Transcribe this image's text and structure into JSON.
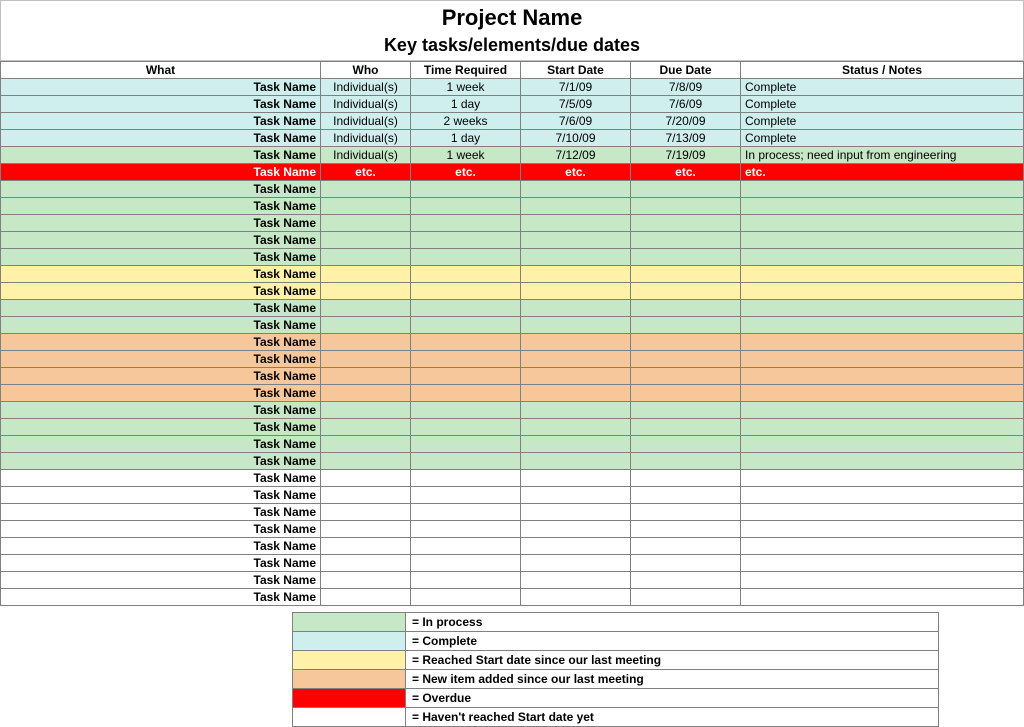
{
  "title": "Project Name",
  "subtitle": "Key tasks/elements/due dates",
  "headers": {
    "what": "What",
    "who": "Who",
    "time": "Time Required",
    "start": "Start Date",
    "due": "Due Date",
    "status": "Status / Notes"
  },
  "rows": [
    {
      "color": "blue",
      "what": "Task Name",
      "who": "Individual(s)",
      "time": "1 week",
      "start": "7/1/09",
      "due": "7/8/09",
      "status": "Complete"
    },
    {
      "color": "blue",
      "what": "Task Name",
      "who": "Individual(s)",
      "time": "1 day",
      "start": "7/5/09",
      "due": "7/6/09",
      "status": "Complete"
    },
    {
      "color": "blue",
      "what": "Task Name",
      "who": "Individual(s)",
      "time": "2 weeks",
      "start": "7/6/09",
      "due": "7/20/09",
      "status": "Complete"
    },
    {
      "color": "blue",
      "what": "Task Name",
      "who": "Individual(s)",
      "time": "1 day",
      "start": "7/10/09",
      "due": "7/13/09",
      "status": "Complete"
    },
    {
      "color": "green",
      "what": "Task Name",
      "who": "Individual(s)",
      "time": "1 week",
      "start": "7/12/09",
      "due": "7/19/09",
      "status": "In process; need input from engineering"
    },
    {
      "color": "red",
      "what": "Task Name",
      "who": "etc.",
      "time": "etc.",
      "start": "etc.",
      "due": "etc.",
      "status": "etc."
    },
    {
      "color": "green",
      "what": "Task Name",
      "who": "",
      "time": "",
      "start": "",
      "due": "",
      "status": ""
    },
    {
      "color": "green",
      "what": "Task Name",
      "who": "",
      "time": "",
      "start": "",
      "due": "",
      "status": ""
    },
    {
      "color": "green",
      "what": "Task Name",
      "who": "",
      "time": "",
      "start": "",
      "due": "",
      "status": ""
    },
    {
      "color": "green",
      "what": "Task Name",
      "who": "",
      "time": "",
      "start": "",
      "due": "",
      "status": ""
    },
    {
      "color": "green",
      "what": "Task Name",
      "who": "",
      "time": "",
      "start": "",
      "due": "",
      "status": ""
    },
    {
      "color": "yellow",
      "what": "Task Name",
      "who": "",
      "time": "",
      "start": "",
      "due": "",
      "status": ""
    },
    {
      "color": "yellow",
      "what": "Task Name",
      "who": "",
      "time": "",
      "start": "",
      "due": "",
      "status": ""
    },
    {
      "color": "green",
      "what": "Task Name",
      "who": "",
      "time": "",
      "start": "",
      "due": "",
      "status": ""
    },
    {
      "color": "green",
      "what": "Task Name",
      "who": "",
      "time": "",
      "start": "",
      "due": "",
      "status": ""
    },
    {
      "color": "orange",
      "what": "Task Name",
      "who": "",
      "time": "",
      "start": "",
      "due": "",
      "status": ""
    },
    {
      "color": "orange",
      "what": "Task Name",
      "who": "",
      "time": "",
      "start": "",
      "due": "",
      "status": ""
    },
    {
      "color": "orange",
      "what": "Task Name",
      "who": "",
      "time": "",
      "start": "",
      "due": "",
      "status": ""
    },
    {
      "color": "orange",
      "what": "Task Name",
      "who": "",
      "time": "",
      "start": "",
      "due": "",
      "status": ""
    },
    {
      "color": "green",
      "what": "Task Name",
      "who": "",
      "time": "",
      "start": "",
      "due": "",
      "status": ""
    },
    {
      "color": "green",
      "what": "Task Name",
      "who": "",
      "time": "",
      "start": "",
      "due": "",
      "status": ""
    },
    {
      "color": "green",
      "what": "Task Name",
      "who": "",
      "time": "",
      "start": "",
      "due": "",
      "status": ""
    },
    {
      "color": "green",
      "what": "Task Name",
      "who": "",
      "time": "",
      "start": "",
      "due": "",
      "status": ""
    },
    {
      "color": "white",
      "what": "Task Name",
      "who": "",
      "time": "",
      "start": "",
      "due": "",
      "status": ""
    },
    {
      "color": "white",
      "what": "Task Name",
      "who": "",
      "time": "",
      "start": "",
      "due": "",
      "status": ""
    },
    {
      "color": "white",
      "what": "Task Name",
      "who": "",
      "time": "",
      "start": "",
      "due": "",
      "status": ""
    },
    {
      "color": "white",
      "what": "Task Name",
      "who": "",
      "time": "",
      "start": "",
      "due": "",
      "status": ""
    },
    {
      "color": "white",
      "what": "Task Name",
      "who": "",
      "time": "",
      "start": "",
      "due": "",
      "status": ""
    },
    {
      "color": "white",
      "what": "Task Name",
      "who": "",
      "time": "",
      "start": "",
      "due": "",
      "status": ""
    },
    {
      "color": "white",
      "what": "Task Name",
      "who": "",
      "time": "",
      "start": "",
      "due": "",
      "status": ""
    },
    {
      "color": "white",
      "what": "Task Name",
      "who": "",
      "time": "",
      "start": "",
      "due": "",
      "status": ""
    }
  ],
  "legend": [
    {
      "color": "green",
      "label": "= In process"
    },
    {
      "color": "blue",
      "label": "= Complete"
    },
    {
      "color": "yellow",
      "label": "= Reached Start date since our last meeting"
    },
    {
      "color": "orange",
      "label": "= New item added since our last meeting"
    },
    {
      "color": "red",
      "label": "= Overdue"
    },
    {
      "color": "white",
      "label": "= Haven't reached Start date yet"
    }
  ]
}
